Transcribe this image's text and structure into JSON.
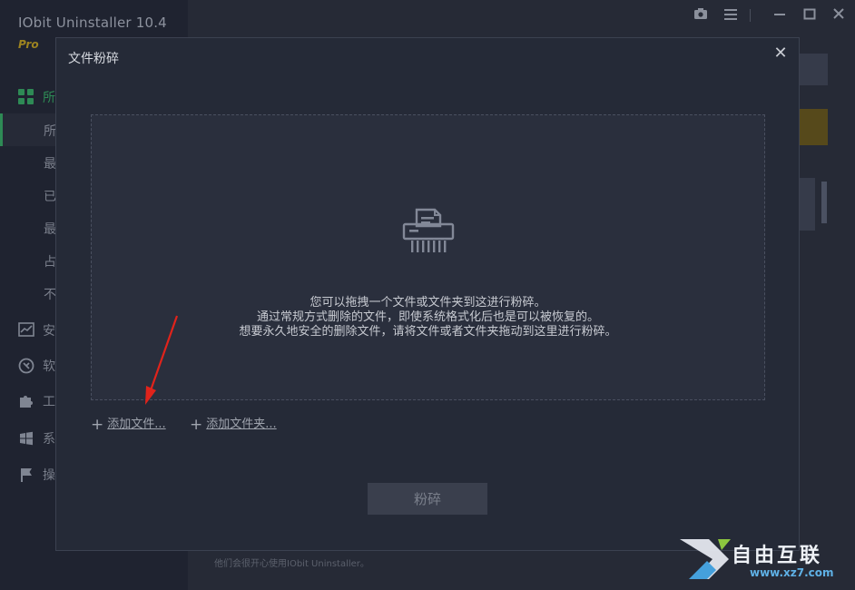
{
  "app": {
    "title": "IObit Uninstaller 10.4",
    "edition": "Pro",
    "sidebar_items": [
      {
        "icon": "apps-grid-icon",
        "label": "所"
      },
      {
        "icon": "",
        "label": "所"
      },
      {
        "icon": "",
        "label": "最"
      },
      {
        "icon": "",
        "label": "已"
      },
      {
        "icon": "",
        "label": "最"
      },
      {
        "icon": "",
        "label": "占"
      },
      {
        "icon": "",
        "label": "不"
      },
      {
        "icon": "chart-icon",
        "label": "安"
      },
      {
        "icon": "store-icon",
        "label": "软"
      },
      {
        "icon": "puzzle-icon",
        "label": "工"
      },
      {
        "icon": "windows-icon",
        "label": "系"
      },
      {
        "icon": "flag-icon",
        "label": "操"
      }
    ],
    "footer_text": "他们会很开心使用IObit Uninstaller。"
  },
  "dialog": {
    "title": "文件粉碎",
    "close_glyph": "✕",
    "drop_lines": [
      "您可以拖拽一个文件或文件夹到这进行粉碎。",
      "通过常规方式删除的文件，即使系统格式化后也是可以被恢复的。",
      "想要永久地安全的删除文件，请将文件或者文件夹拖动到这里进行粉碎。"
    ],
    "add_file_label": "添加文件...",
    "add_folder_label": "添加文件夹...",
    "plus_glyph": "+",
    "shred_button_label": "粉碎"
  },
  "watermark": {
    "text": "自由互联",
    "url": "www.xz7.com"
  },
  "colors": {
    "accent_green": "#2e8a55",
    "annotation_red": "#e0231b",
    "edition_gold": "#9c8320"
  }
}
